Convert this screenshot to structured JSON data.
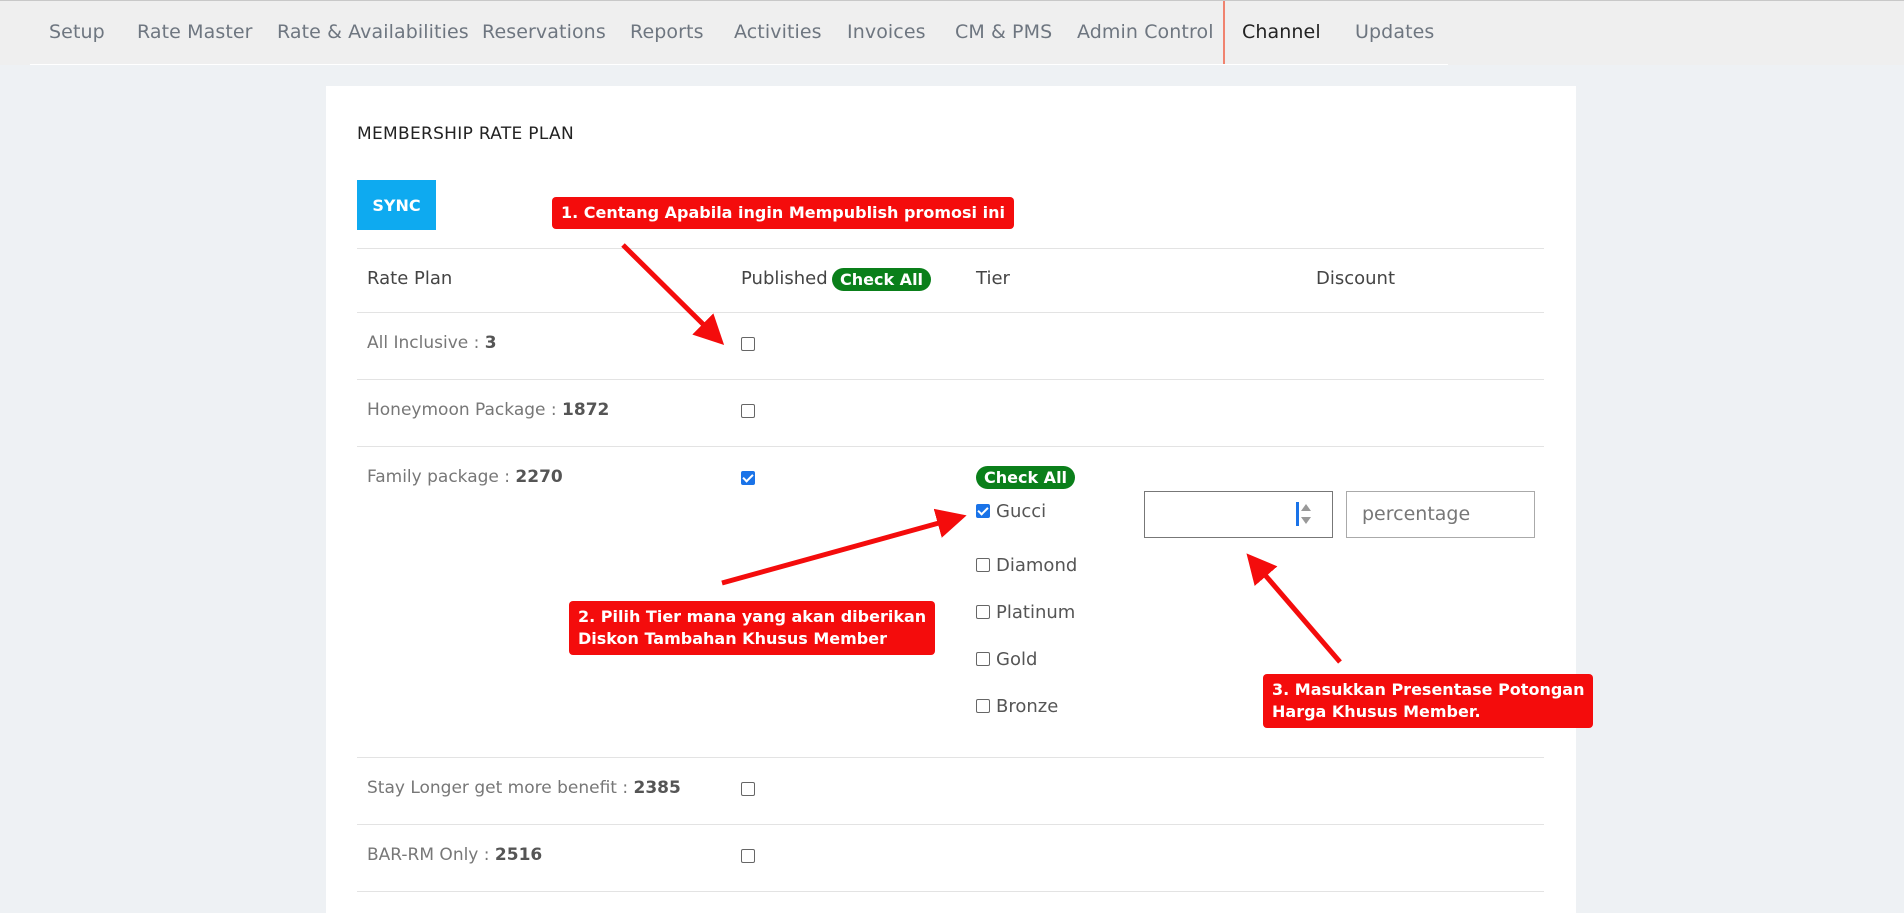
{
  "nav": {
    "items": [
      "Setup",
      "Rate Master",
      "Rate & Availabilities",
      "Reservations",
      "Reports",
      "Activities",
      "Invoices",
      "CM & PMS",
      "Admin Control",
      "Channel",
      "Updates"
    ],
    "active": "Channel"
  },
  "section": {
    "title": "MEMBERSHIP RATE PLAN",
    "sync_label": "SYNC"
  },
  "table": {
    "headers": {
      "rate_plan": "Rate Plan",
      "published": "Published",
      "check_all": "Check All",
      "tier": "Tier",
      "discount": "Discount"
    },
    "rows": [
      {
        "name": "All Inclusive : ",
        "id": "3",
        "published": false
      },
      {
        "name": "Honeymoon Package : ",
        "id": "1872",
        "published": false
      },
      {
        "name": "Family package : ",
        "id": "2270",
        "published": true
      },
      {
        "name": "Stay Longer get more benefit : ",
        "id": "2385",
        "published": false
      },
      {
        "name": "BAR-RM Only : ",
        "id": "2516",
        "published": false
      }
    ],
    "tier_check_all": "Check All",
    "tiers": [
      {
        "label": "Gucci",
        "checked": true
      },
      {
        "label": "Diamond",
        "checked": false
      },
      {
        "label": "Platinum",
        "checked": false
      },
      {
        "label": "Gold",
        "checked": false
      },
      {
        "label": "Bronze",
        "checked": false
      }
    ],
    "discount_value": "",
    "discount_type_placeholder": "percentage"
  },
  "callouts": {
    "c1": "1. Centang Apabila ingin Mempublish promosi ini",
    "c2_line1": "2. Pilih Tier mana yang akan diberikan",
    "c2_line2": "Diskon Tambahan Khusus Member",
    "c3_line1": "3. Masukkan Presentase Potongan",
    "c3_line2": "Harga Khusus Member."
  },
  "colors": {
    "accent": "#0eaaf0",
    "badge": "#0a7f1a",
    "callout": "#f40c0c",
    "checkbox_checked": "#1a73e8"
  }
}
